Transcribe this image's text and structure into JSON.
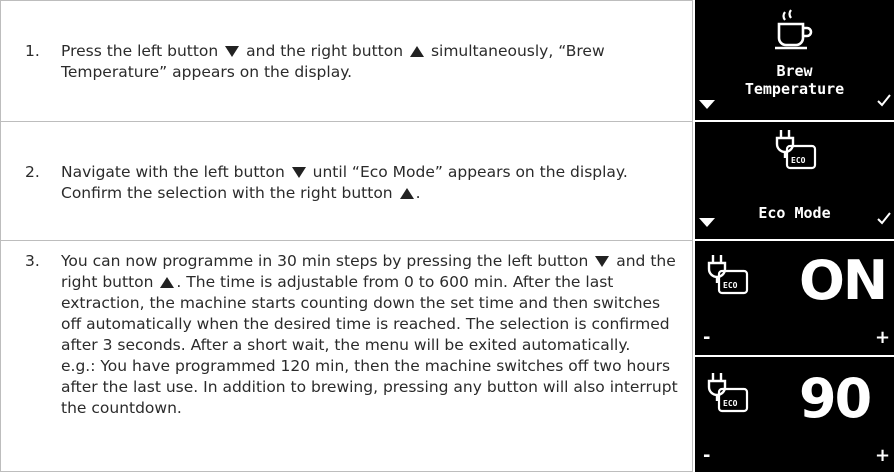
{
  "steps": [
    {
      "number": "1.",
      "text_a": "Press the left button",
      "text_b": "and the right button",
      "text_c": "simultaneously, “Brew Temperature” appears on the display."
    },
    {
      "number": "2.",
      "text_a": "Navigate with the left button",
      "text_b": "until “Eco Mode” appears on the display. Confirm the selection with the right button",
      "text_c": "."
    },
    {
      "number": "3.",
      "text_a": "You can now programme in 30 min steps by pressing the left button",
      "text_b": "and the right button",
      "text_c": ". The time is adjustable from 0 to 600 min. After the last extraction, the machine starts counting down the set time and then switches off automatically when the desired time is reached. The selection is confirmed after 3 seconds. After a short wait, the menu will be exited automatically.",
      "text_d": "e.g.: You have programmed 120 min, then the machine switches off two hours after the last use. In addition to brewing, pressing any button will also interrupt the countdown."
    }
  ],
  "displays": {
    "brew": {
      "line1": "Brew",
      "line2": "Temperature",
      "icon": "coffee-cup-icon"
    },
    "eco": {
      "label": "Eco Mode",
      "badge": "ECO",
      "icon": "plug-eco-icon"
    },
    "on": {
      "value": "ON",
      "badge": "ECO",
      "minus": "-",
      "plus": "+"
    },
    "ninety": {
      "value": "90",
      "badge": "ECO",
      "minus": "-",
      "plus": "+"
    }
  },
  "colors": {
    "screen_bg": "#000000",
    "screen_fg": "#ffffff",
    "border": "#bdbdbd",
    "text": "#2b2b2b"
  }
}
